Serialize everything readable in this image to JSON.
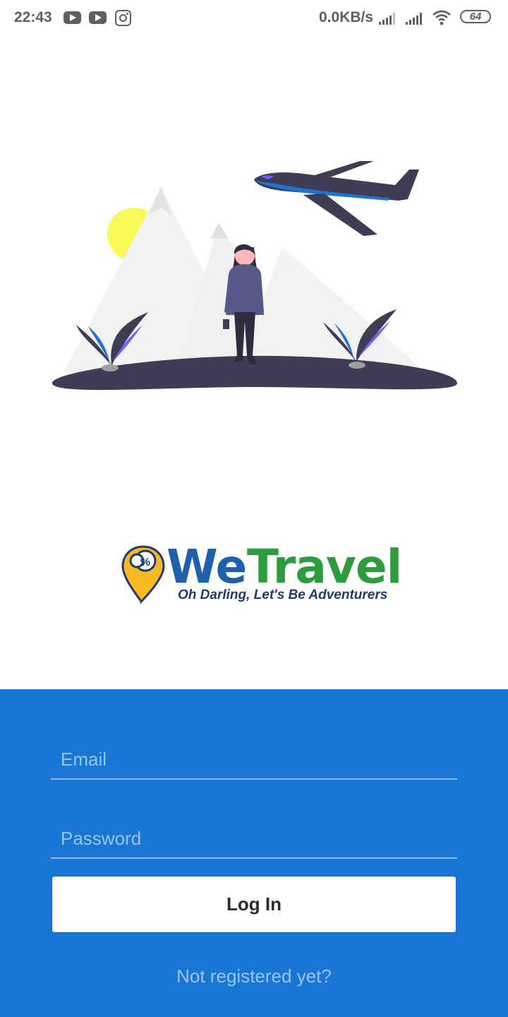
{
  "status_bar": {
    "time": "22:43",
    "net_speed": "0.0KB/s",
    "battery": "64",
    "icons": [
      "youtube-icon",
      "youtube-icon",
      "instagram-icon",
      "signal-icon",
      "signal-icon",
      "wifi-icon",
      "battery-icon"
    ]
  },
  "logo": {
    "word1": "We",
    "word2": "Travel",
    "tagline": "Oh Darling, Let's Be Adventurers",
    "pin_symbol": "%"
  },
  "login": {
    "email_placeholder": "Email",
    "password_placeholder": "Password",
    "login_button": "Log In",
    "register_link": "Not registered yet?"
  },
  "colors": {
    "panel": "#1976d4",
    "logo_blue": "#1e5fae",
    "logo_green": "#2c9c3c",
    "illustration_dark": "#3f3d56",
    "sun": "#f9f95a"
  }
}
